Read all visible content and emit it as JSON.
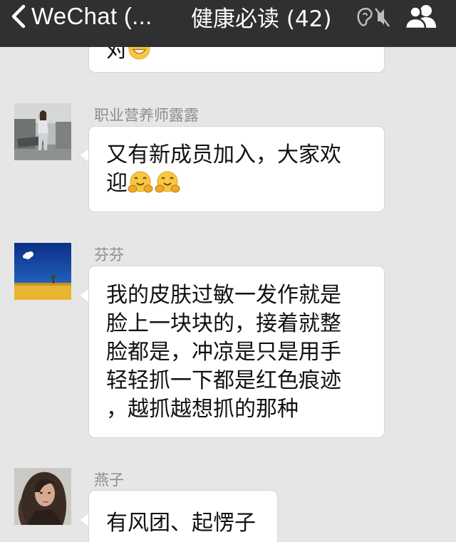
{
  "nav": {
    "back_label": "WeChat (...",
    "title": "健康必读 (42)",
    "icons": {
      "back": "chevron-left-icon",
      "mute": "earpiece-mute-icon",
      "members": "group-members-icon"
    }
  },
  "colors": {
    "navbar_bg": "#2e3032",
    "chat_bg": "#e6e6e6",
    "bubble_bg": "#ffffff",
    "sender_name": "#8c8c8c"
  },
  "messages": [
    {
      "sender": "",
      "lines": [
        "对"
      ],
      "emoji": [
        "grinning-face"
      ]
    },
    {
      "sender": "职业营养师露露",
      "lines": [
        "又有新成员加入，大家欢",
        "迎"
      ],
      "emoji": [
        "hugging-face",
        "hugging-face"
      ]
    },
    {
      "sender": "芬芬",
      "lines": [
        "我的皮肤过敏一发作就是",
        "脸上一块块的，接着就整",
        "脸都是，冲凉是只是用手",
        "轻轻抓一下都是红色痕迹",
        "，越抓越想抓的那种"
      ]
    },
    {
      "sender": "燕子",
      "lines": [
        "有风团、起愣子"
      ]
    }
  ]
}
